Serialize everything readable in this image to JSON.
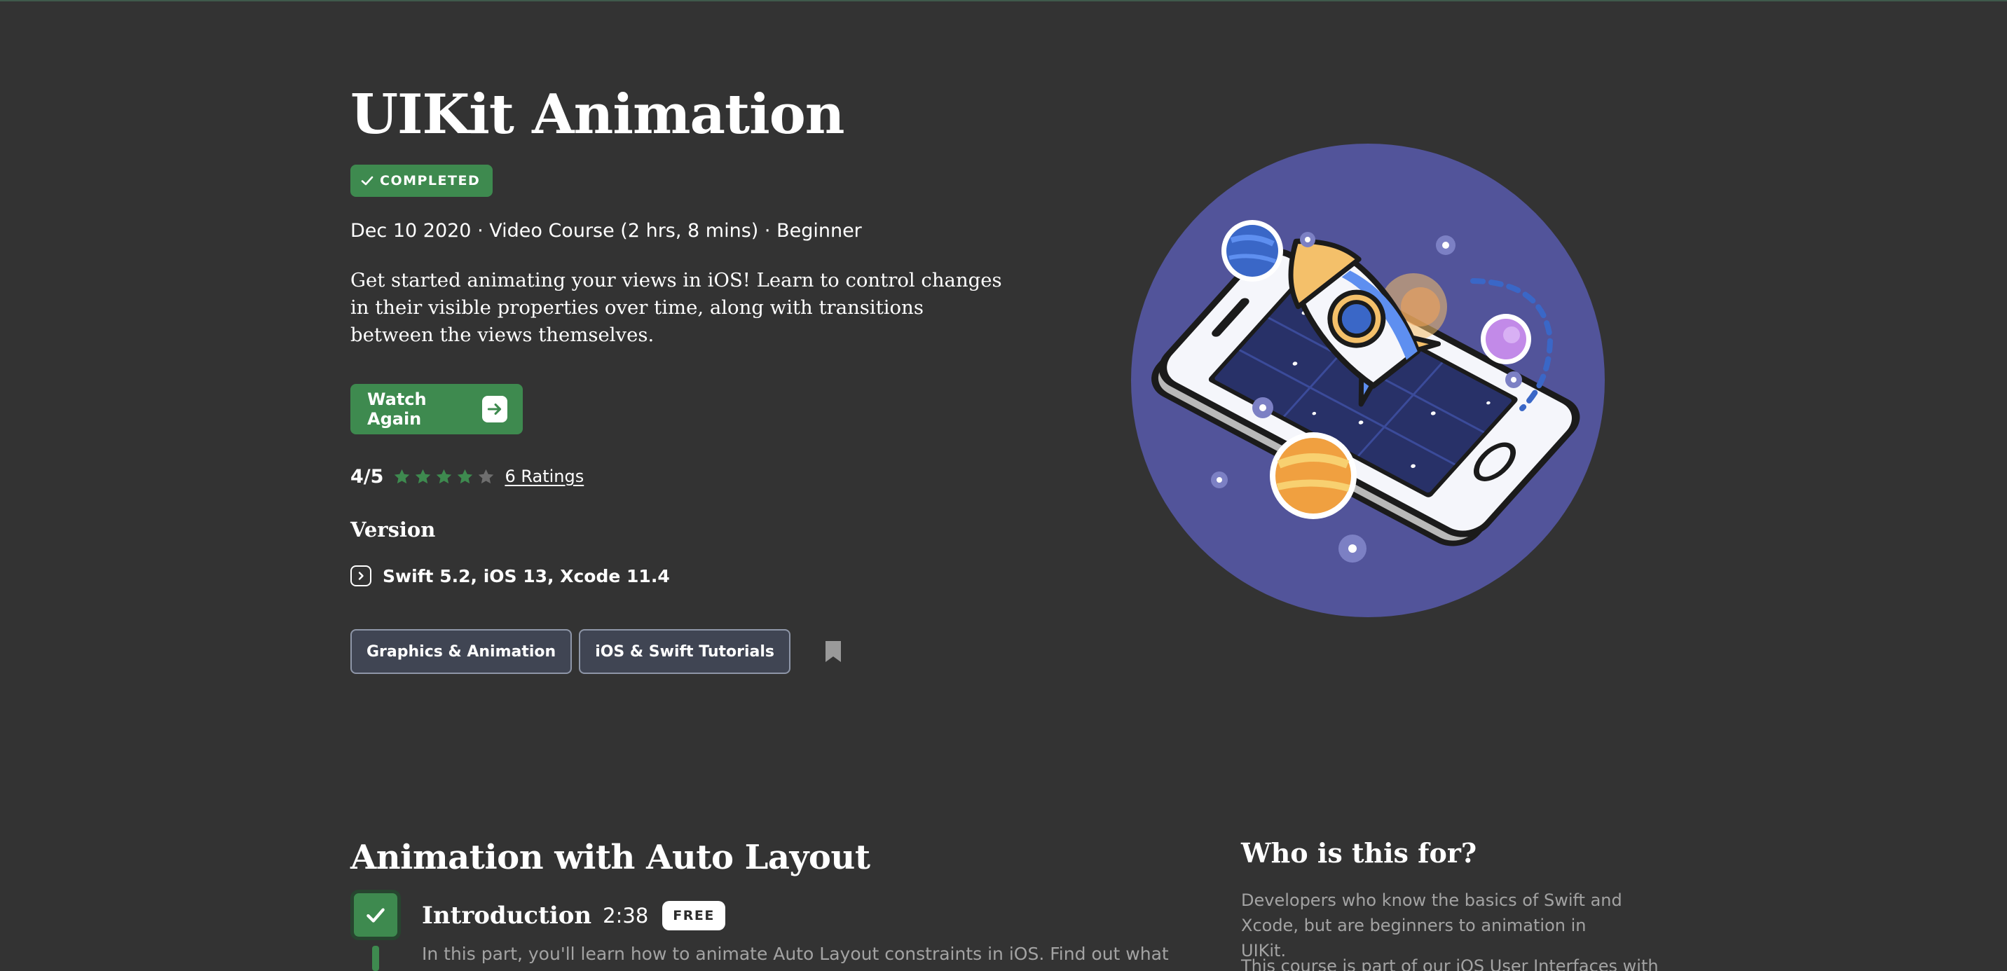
{
  "course": {
    "title": "UIKit Animation",
    "status_badge": "COMPLETED",
    "meta": "Dec 10 2020 · Video Course (2 hrs, 8 mins) · Beginner",
    "description": "Get started animating your views in iOS! Learn to control changes in their visible properties over time, along with transitions between the views themselves.",
    "watch_button_label": "Watch Again",
    "rating": {
      "score": "4/5",
      "stars_filled": 4,
      "stars_total": 5,
      "ratings_link": "6 Ratings"
    },
    "version_heading": "Version",
    "version_text": "Swift 5.2, iOS 13, Xcode 11.4",
    "tags": [
      "Graphics & Animation",
      "iOS & Swift Tutorials"
    ],
    "hero_image": "rocket-launching-from-iphone-illustration"
  },
  "section": {
    "heading": "Animation with Auto Layout",
    "lesson": {
      "title": "Introduction",
      "duration": "2:38",
      "badge": "FREE",
      "description": "In this part, you'll learn how to animate Auto Layout constraints in iOS. Find out what"
    }
  },
  "sidebar": {
    "heading": "Who is this for?",
    "text": "Developers who know the basics of Swift and Xcode, but are beginners to animation in UIKit.",
    "text_2": "This course is part of our iOS User Interfaces with"
  },
  "colors": {
    "background": "#333333",
    "accent_green": "#3e8a4f",
    "star_filled": "#3e8a4f",
    "star_empty": "#6e6e6e",
    "tag_border": "#8e96a8",
    "hero_circle": "#52549a",
    "muted_text": "#a3a3a3"
  },
  "icons": {
    "badge_check": "check-icon",
    "watch_arrow": "arrow-right-icon",
    "star": "star-icon",
    "version": "chevron-right-icon",
    "bookmark": "bookmark-icon",
    "lesson_check": "check-icon"
  }
}
